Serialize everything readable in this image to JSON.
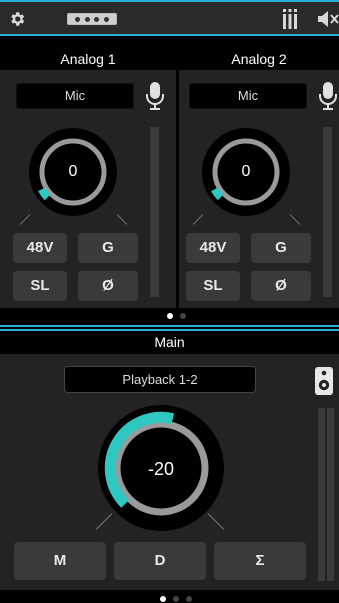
{
  "toolbar": {
    "settings_icon": "gear-icon",
    "device_icon": "device-icon",
    "mixer_icon": "mixer-icon",
    "speaker_icon": "speaker-mute-icon"
  },
  "channels": [
    {
      "name": "Analog 1",
      "source": "Mic",
      "gain": "0",
      "gain_level": 0.05,
      "buttons": [
        "48V",
        "G",
        "SL",
        "Ø"
      ]
    },
    {
      "name": "Analog 2",
      "source": "Mic",
      "gain": "0",
      "gain_level": 0.05,
      "buttons": [
        "48V",
        "G",
        "SL",
        "Ø"
      ]
    }
  ],
  "main": {
    "title": "Main",
    "output": "Playback 1-2",
    "volume": "-20",
    "volume_level": 0.55,
    "buttons": [
      "M",
      "D",
      "Σ"
    ]
  },
  "colors": {
    "accent": "#27b3d8",
    "knob_arc": "#2ec8c0",
    "panel": "#232323"
  }
}
